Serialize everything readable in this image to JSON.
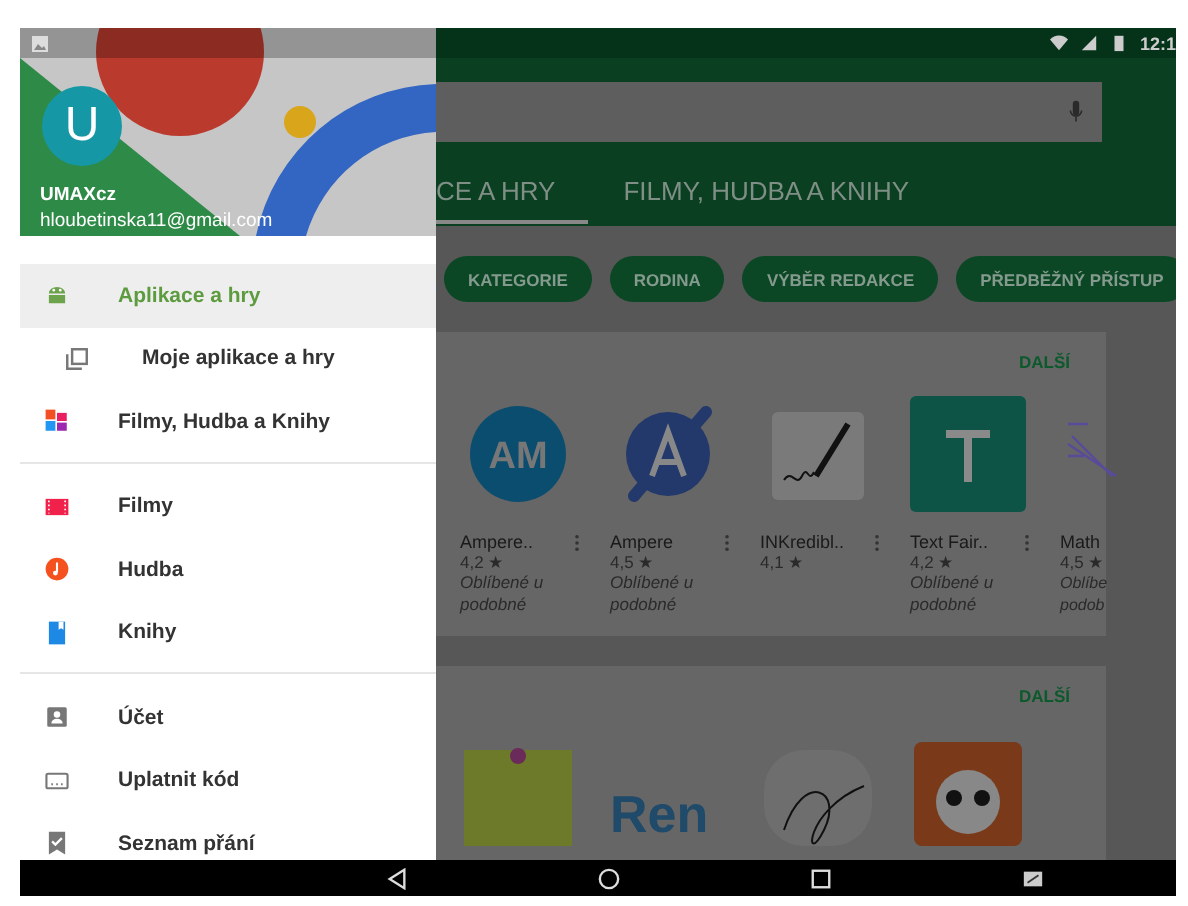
{
  "status_bar": {
    "time": "12:1"
  },
  "drawer": {
    "account": {
      "avatar_letter": "U",
      "name": "UMAXcz",
      "email": "hloubetinska11@gmail.com"
    },
    "sections": [
      {
        "items": [
          {
            "kind": "android",
            "label": "Aplikace a hry",
            "selected": true,
            "children": [
              {
                "kind": "library",
                "label": "Moje aplikace a hry",
                "selected": false
              }
            ]
          },
          {
            "kind": "media",
            "label": "Filmy, Hudba a Knihy",
            "selected": false
          }
        ]
      },
      {
        "items": [
          {
            "kind": "movies",
            "label": "Filmy",
            "selected": false
          },
          {
            "kind": "music",
            "label": "Hudba",
            "selected": false
          },
          {
            "kind": "books",
            "label": "Knihy",
            "selected": false
          }
        ]
      },
      {
        "items": [
          {
            "kind": "account",
            "label": "Účet",
            "selected": false
          },
          {
            "kind": "redeem",
            "label": "Uplatnit kód",
            "selected": false
          },
          {
            "kind": "wishlist",
            "label": "Seznam přání",
            "selected": false
          }
        ]
      }
    ]
  },
  "tabs": [
    {
      "label": "CE A HRY",
      "selected": true
    },
    {
      "label": "FILMY, HUDBA A KNIHY",
      "selected": false
    }
  ],
  "chips": [
    "KATEGORIE",
    "RODINA",
    "VÝBĚR REDAKCE",
    "PŘEDBĚŽNÝ PŘÍSTUP"
  ],
  "cards": [
    {
      "more": "DALŠÍ",
      "apps": [
        {
          "kind": "am",
          "icon_text": "AM",
          "name": "Ampere..",
          "rating": "4,2 ★",
          "note": "Oblíbené u podobné"
        },
        {
          "kind": "a",
          "name": "Ampere",
          "rating": "4,5 ★",
          "note": "Oblíbené u podobné"
        },
        {
          "kind": "pen",
          "name": "INKredibl..",
          "rating": "4,1 ★"
        },
        {
          "kind": "t",
          "name": "Text Fair..",
          "rating": "4,2 ★",
          "note": "Oblíbené u podobné"
        },
        {
          "kind": "math",
          "name": "Math",
          "rating": "4,5 ★",
          "note": "Oblíbe podob"
        }
      ]
    },
    {
      "more": "DALŠÍ",
      "apps": [
        {
          "kind": "note"
        },
        {
          "kind": "wordmark",
          "text": "Ren"
        },
        {
          "kind": "signature"
        },
        {
          "kind": "panda"
        }
      ]
    }
  ]
}
